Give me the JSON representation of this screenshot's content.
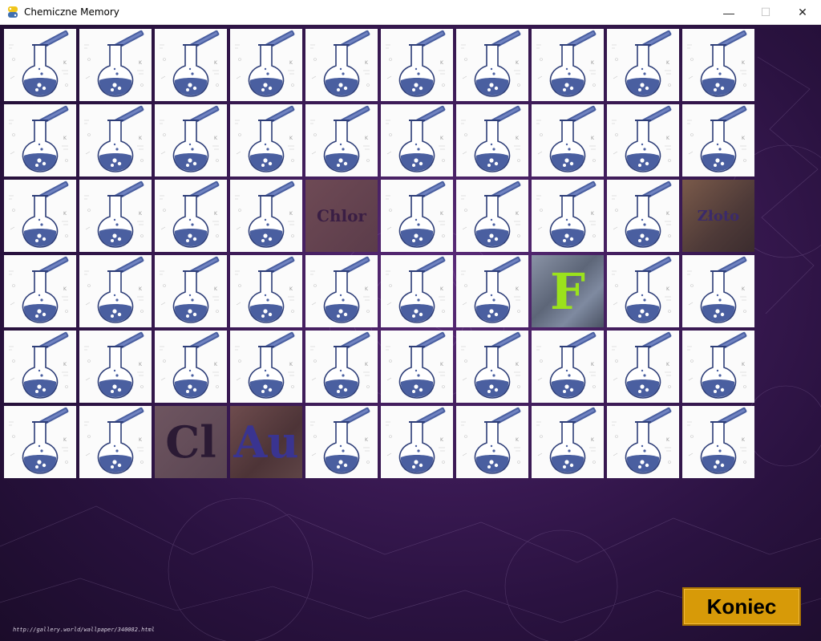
{
  "window": {
    "title": "Chemiczne Memory",
    "icon": "python-icon",
    "controls": {
      "minimize": "—",
      "maximize": "☐",
      "close": "✕"
    }
  },
  "board": {
    "rows": 6,
    "cols": 10,
    "back_icon": "flask-icon",
    "revealed": [
      {
        "row": 2,
        "col": 4,
        "text": "Chlor",
        "style": "chlor",
        "color": "#3a1e44"
      },
      {
        "row": 2,
        "col": 9,
        "text": "Złoto",
        "style": "zloto",
        "color": "#3b2a6a"
      },
      {
        "row": 3,
        "col": 7,
        "text": "F",
        "style": "f",
        "color": "#9be21c"
      },
      {
        "row": 5,
        "col": 2,
        "text": "Cl",
        "style": "cl",
        "color": "#2b1a34"
      },
      {
        "row": 5,
        "col": 3,
        "text": "Au",
        "style": "au",
        "color": "#3a3490"
      }
    ]
  },
  "koniec_button": {
    "label": "Koniec"
  },
  "watermark": "http://gallery.world/wallpaper/340082.html"
}
